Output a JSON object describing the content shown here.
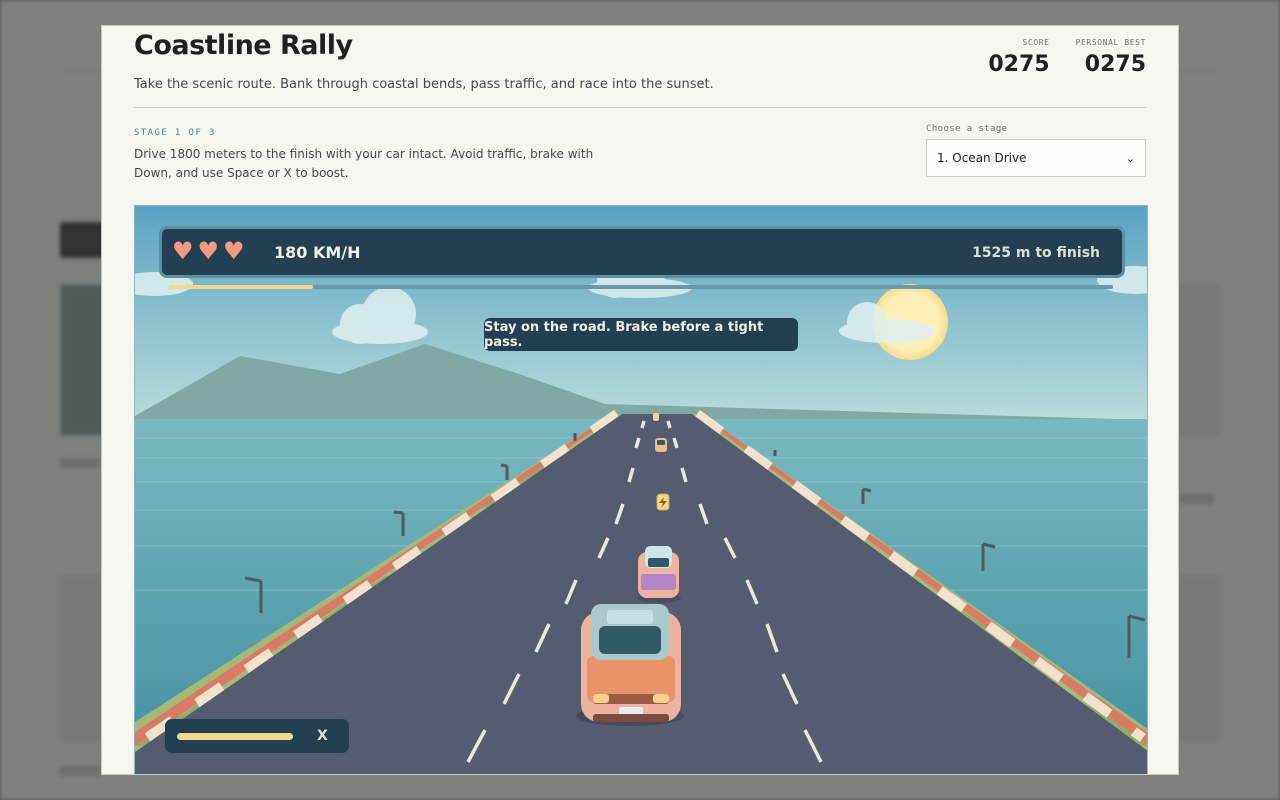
{
  "game": {
    "title": "Coastline Rally",
    "tagline": "Take the scenic route. Bank through coastal bends, pass traffic, and race into the sunset.",
    "score_label": "SCORE",
    "score": "0275",
    "best_label": "PERSONAL BEST",
    "best": "0275"
  },
  "stage": {
    "kicker": "STAGE 1 OF 3",
    "description": "Drive 1800 meters to the finish with your car intact. Avoid traffic, brake with Down, and use Space or X to boost.",
    "select_label": "Choose a stage",
    "selected": "1. Ocean Drive"
  },
  "hud": {
    "lives": 3,
    "speed": "180 KM/H",
    "remaining": "1525 m to finish",
    "progress": 0.153,
    "tip": "Stay on the road. Brake before a tight pass.",
    "boost_level": 1.0,
    "boost_key": "X"
  },
  "colors": {
    "sky_top": "#5aa3c4",
    "sky_bottom": "#b8dcd9",
    "sea": "#4f9aa9",
    "road": "#555c70",
    "grass": "#a6b878",
    "hud": "#224052",
    "accent": "#f3d98c",
    "heart": "#f39a80",
    "player_car": "#f0a070"
  },
  "icons": {
    "heart": "heart-icon",
    "chevron": "chevron-down-icon",
    "boost_pickup": "lightning-icon"
  }
}
